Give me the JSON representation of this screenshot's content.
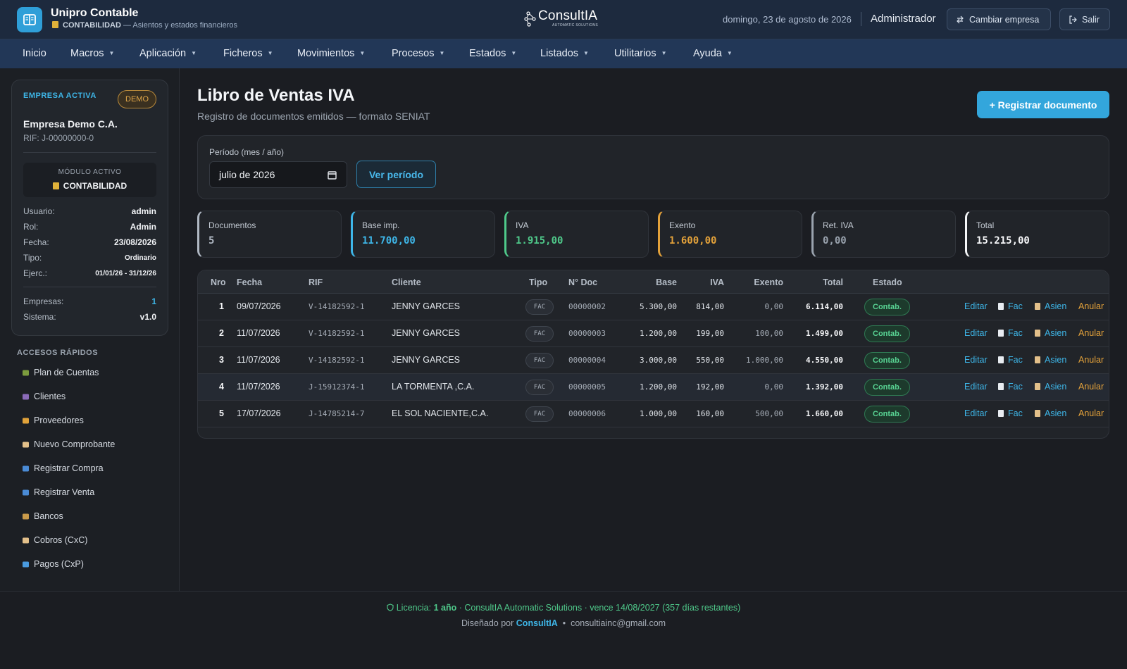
{
  "app": {
    "title": "Unipro Contable",
    "module": "CONTABILIDAD",
    "module_desc": "— Asientos y estados financieros"
  },
  "brand": {
    "name": "ConsultIA",
    "tagline": "AUTOMATIC SOLUTIONS"
  },
  "header": {
    "date": "domingo, 23 de agosto de 2026",
    "user": "Administrador",
    "switch_company": "Cambiar empresa",
    "logout": "Salir"
  },
  "nav": [
    "Inicio",
    "Macros",
    "Aplicación",
    "Ficheros",
    "Movimientos",
    "Procesos",
    "Estados",
    "Listados",
    "Utilitarios",
    "Ayuda"
  ],
  "sidebar": {
    "active_company_label": "EMPRESA ACTIVA",
    "badge": "DEMO",
    "company_name": "Empresa Demo C.A.",
    "company_rif": "RIF: J-00000000-0",
    "module_label": "MÓDULO ACTIVO",
    "module_value": "CONTABILIDAD",
    "info": [
      {
        "k": "Usuario:",
        "v": "admin"
      },
      {
        "k": "Rol:",
        "v": "Admin"
      },
      {
        "k": "Fecha:",
        "v": "23/08/2026"
      },
      {
        "k": "Tipo:",
        "v": "Ordinario"
      },
      {
        "k": "Ejerc.:",
        "v": "01/01/26 - 31/12/26"
      },
      {
        "k": "Empresas:",
        "v": "1"
      },
      {
        "k": "Sistema:",
        "v": "v1.0"
      }
    ],
    "quick_title": "ACCESOS RÁPIDOS",
    "quick": [
      {
        "label": "Plan de Cuentas",
        "icon": "books-icon",
        "color": "#7c9c3e"
      },
      {
        "label": "Clientes",
        "icon": "people-icon",
        "color": "#8a6ab8"
      },
      {
        "label": "Proveedores",
        "icon": "truck-icon",
        "color": "#e0a23a"
      },
      {
        "label": "Nuevo Comprobante",
        "icon": "memo-icon",
        "color": "#e3c08a"
      },
      {
        "label": "Registrar Compra",
        "icon": "cart-icon",
        "color": "#4a8bd6"
      },
      {
        "label": "Registrar Venta",
        "icon": "register-icon",
        "color": "#4a8bd6"
      },
      {
        "label": "Bancos",
        "icon": "money-bag-icon",
        "color": "#c99a4a"
      },
      {
        "label": "Cobros (CxC)",
        "icon": "receipt-icon",
        "color": "#e3c08a"
      },
      {
        "label": "Pagos (CxP)",
        "icon": "card-icon",
        "color": "#4a9be0"
      }
    ]
  },
  "page": {
    "title": "Libro de Ventas IVA",
    "subtitle": "Registro de documentos emitidos — formato SENIAT",
    "primary_button": "+ Registrar documento",
    "period_label": "Período (mes / año)",
    "period_value": "julio de 2026",
    "period_button": "Ver período"
  },
  "stats": [
    {
      "label": "Documentos",
      "value": "5",
      "color": "#b0b8c3"
    },
    {
      "label": "Base imp.",
      "value": "11.700,00",
      "color": "#3eb6e8"
    },
    {
      "label": "IVA",
      "value": "1.915,00",
      "color": "#4fc98a"
    },
    {
      "label": "Exento",
      "value": "1.600,00",
      "color": "#e4a23a"
    },
    {
      "label": "Ret. IVA",
      "value": "0,00",
      "color": "#9aa3ae"
    },
    {
      "label": "Total",
      "value": "15.215,00",
      "color": "#f6f7f9"
    }
  ],
  "table": {
    "headers": [
      "Nro",
      "Fecha",
      "RIF",
      "Cliente",
      "Tipo",
      "N° Doc",
      "Base",
      "IVA",
      "Exento",
      "Total",
      "Estado"
    ],
    "actions": [
      "Editar",
      "Fac",
      "Asien",
      "Anular"
    ],
    "rows": [
      {
        "nro": "1",
        "fecha": "09/07/2026",
        "rif": "V-14182592-1",
        "cliente": "JENNY GARCES",
        "tipo": "FAC",
        "doc": "00000002",
        "base": "5.300,00",
        "iva": "814,00",
        "exento": "0,00",
        "total": "6.114,00",
        "estado": "Contab."
      },
      {
        "nro": "2",
        "fecha": "11/07/2026",
        "rif": "V-14182592-1",
        "cliente": "JENNY GARCES",
        "tipo": "FAC",
        "doc": "00000003",
        "base": "1.200,00",
        "iva": "199,00",
        "exento": "100,00",
        "total": "1.499,00",
        "estado": "Contab."
      },
      {
        "nro": "3",
        "fecha": "11/07/2026",
        "rif": "V-14182592-1",
        "cliente": "JENNY GARCES",
        "tipo": "FAC",
        "doc": "00000004",
        "base": "3.000,00",
        "iva": "550,00",
        "exento": "1.000,00",
        "total": "4.550,00",
        "estado": "Contab."
      },
      {
        "nro": "4",
        "fecha": "11/07/2026",
        "rif": "J-15912374-1",
        "cliente": "LA TORMENTA ,C.A.",
        "tipo": "FAC",
        "doc": "00000005",
        "base": "1.200,00",
        "iva": "192,00",
        "exento": "0,00",
        "total": "1.392,00",
        "estado": "Contab."
      },
      {
        "nro": "5",
        "fecha": "17/07/2026",
        "rif": "J-14785214-7",
        "cliente": "EL SOL NACIENTE,C.A.",
        "tipo": "FAC",
        "doc": "00000006",
        "base": "1.000,00",
        "iva": "160,00",
        "exento": "500,00",
        "total": "1.660,00",
        "estado": "Contab."
      }
    ]
  },
  "footer": {
    "license_prefix": "Licencia:",
    "license_term": "1 año",
    "license_rest": "· ConsultIA Automatic Solutions · vence 14/08/2027 (357 días restantes)",
    "designed_by": "Diseñado por",
    "designer": "ConsultIA",
    "email": "consultiainc@gmail.com"
  }
}
